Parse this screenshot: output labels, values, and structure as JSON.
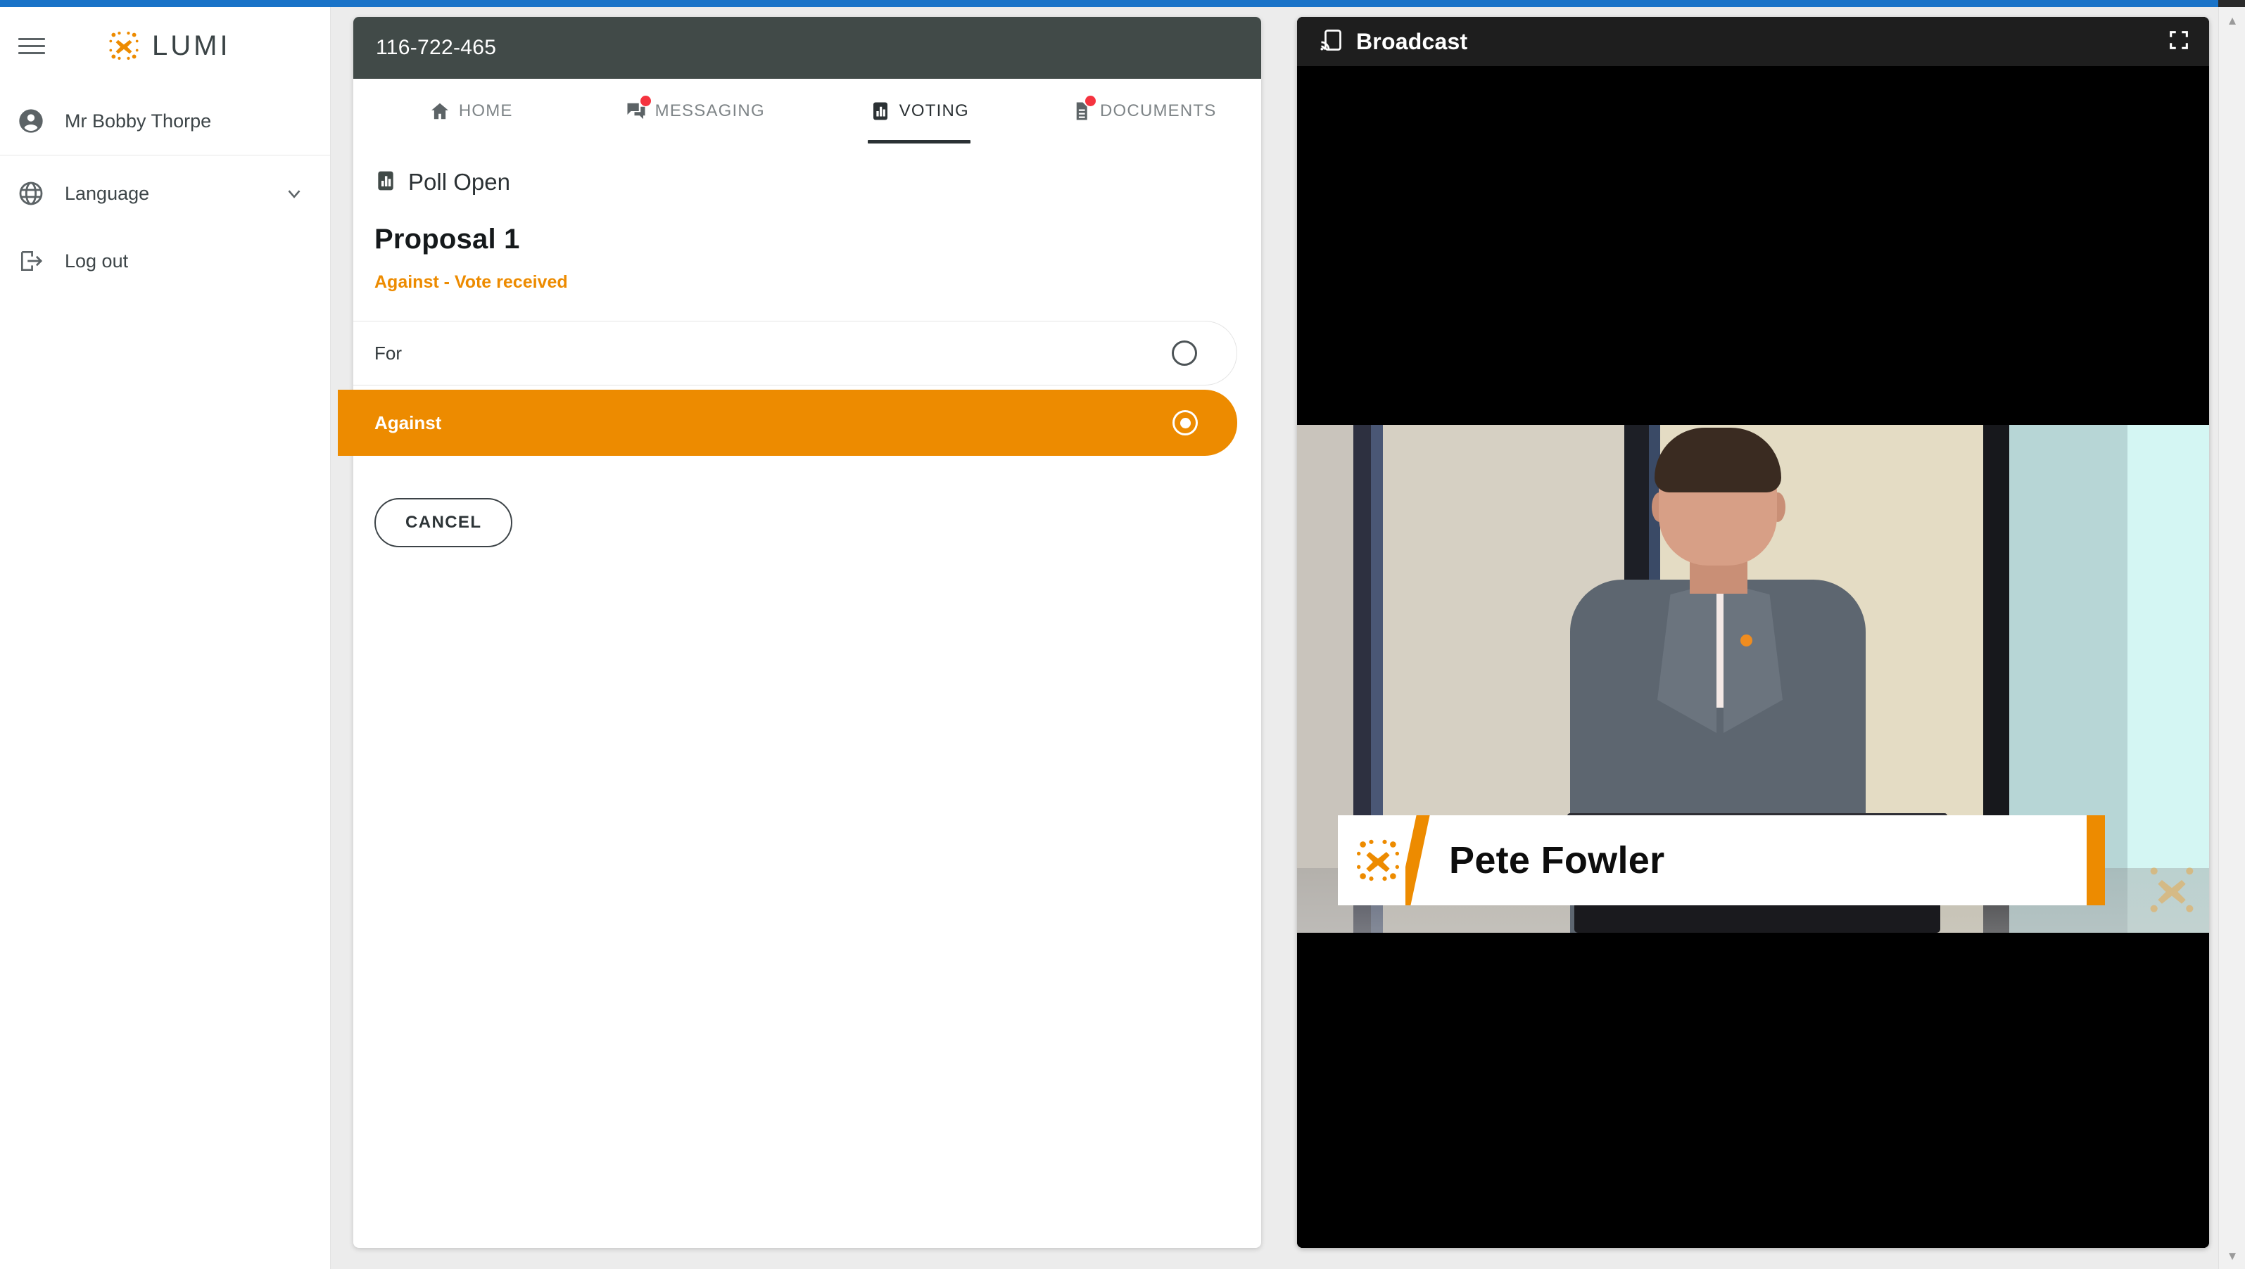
{
  "app": {
    "brand_word": "LUMI",
    "accent_color": "#ED8B00",
    "header_color": "#414A48",
    "badge_color": "#F5333F"
  },
  "sidebar": {
    "menu_icon": "hamburger-icon",
    "items": [
      {
        "label": "Mr Bobby Thorpe",
        "icon": "account-circle-icon",
        "chevron": ""
      },
      {
        "label": "Language",
        "icon": "globe-icon",
        "chevron": "⌄"
      },
      {
        "label": "Log out",
        "icon": "logout-icon",
        "chevron": ""
      }
    ]
  },
  "meeting": {
    "id": "116-722-465"
  },
  "tabs": [
    {
      "label": "HOME",
      "icon": "home-icon",
      "active": false,
      "badge": false
    },
    {
      "label": "MESSAGING",
      "icon": "message-icon",
      "active": false,
      "badge": true
    },
    {
      "label": "VOTING",
      "icon": "bar-chart-icon",
      "active": true,
      "badge": false
    },
    {
      "label": "DOCUMENTS",
      "icon": "document-icon",
      "active": false,
      "badge": true
    }
  ],
  "voting": {
    "poll_status": "Poll Open",
    "poll_status_icon": "bar-chart-icon",
    "proposal_title": "Proposal 1",
    "vote_receipt": "Against - Vote received",
    "options": [
      {
        "label": "For",
        "selected": false
      },
      {
        "label": "Against",
        "selected": true
      }
    ],
    "cancel_label": "CANCEL"
  },
  "broadcast": {
    "title": "Broadcast",
    "cast_icon": "cast-icon",
    "fullscreen_icon": "fullscreen-icon",
    "speaker_name": "Pete Fowler",
    "banner_logo": "lumi-x-logo"
  },
  "scrollbar": {
    "up_arrow": "▲",
    "down_arrow": "▼"
  }
}
